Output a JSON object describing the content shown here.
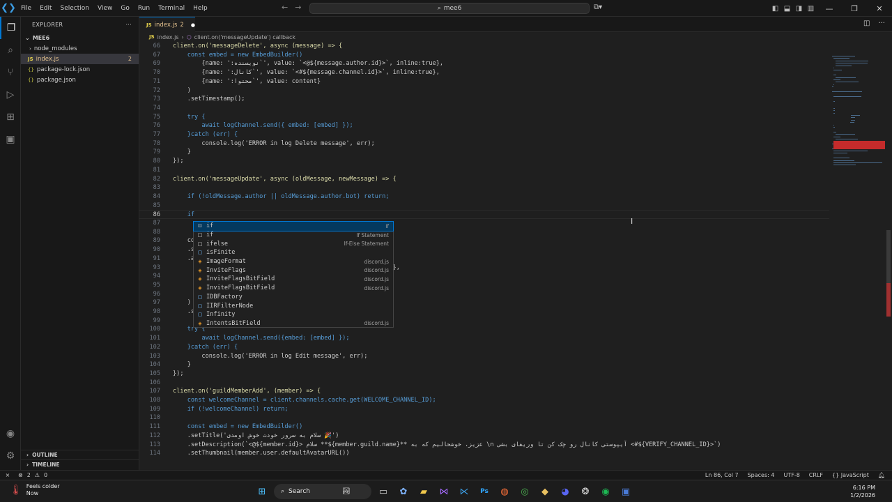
{
  "titlebar": {
    "menu": [
      "File",
      "Edit",
      "Selection",
      "View",
      "Go",
      "Run",
      "Terminal",
      "Help"
    ],
    "search": "mee6"
  },
  "sidebar": {
    "header": "EXPLORER",
    "folder": "MEE6",
    "items": [
      {
        "label": "node_modules",
        "type": "folder"
      },
      {
        "label": "index.js",
        "type": "js",
        "badge": "2"
      },
      {
        "label": "package-lock.json",
        "type": "json"
      },
      {
        "label": "package.json",
        "type": "json"
      }
    ],
    "outline": "OUTLINE",
    "timeline": "TIMELINE"
  },
  "editor": {
    "tab_name": "index.js",
    "tab_badge": "2",
    "breadcrumb": [
      "index.js",
      "client.on('messageUpdate') callback"
    ],
    "lines": [
      {
        "n": "66",
        "t": "client.on('messageDelete', async (message) => {"
      },
      {
        "n": "67",
        "t": "    const embed = new EmbedBuilder()"
      },
      {
        "n": "69",
        "t": "        {name: ':نویسنده`', value: `<@${message.author.id}>`, inline:true},"
      },
      {
        "n": "70",
        "t": "        {name: ':کانال`', value: `<#${message.channel.id}>`, inline:true},"
      },
      {
        "n": "71",
        "t": "        {name: ':محتوا`', value: content}"
      },
      {
        "n": "72",
        "t": "    )"
      },
      {
        "n": "73",
        "t": "    .setTimestamp();"
      },
      {
        "n": "74",
        "t": ""
      },
      {
        "n": "75",
        "t": "    try {"
      },
      {
        "n": "76",
        "t": "        await logChannel.send({ embed: [embed] });"
      },
      {
        "n": "77",
        "t": "    }catch (err) {"
      },
      {
        "n": "78",
        "t": "        console.log('ERROR in log Delete message', err);"
      },
      {
        "n": "79",
        "t": "    }"
      },
      {
        "n": "80",
        "t": "});"
      },
      {
        "n": "81",
        "t": ""
      },
      {
        "n": "82",
        "t": "client.on('messageUpdate', async (oldMessage, newMessage) => {"
      },
      {
        "n": "83",
        "t": ""
      },
      {
        "n": "84",
        "t": "    if (!oldMessage.author || oldMessage.author.bot) return;"
      },
      {
        "n": "85",
        "t": ""
      },
      {
        "n": "86",
        "t": "    if"
      },
      {
        "n": "87",
        "t": ""
      },
      {
        "n": "88",
        "t": ""
      },
      {
        "n": "89",
        "t": "    co"
      },
      {
        "n": "90",
        "t": "    .s"
      },
      {
        "n": "91",
        "t": "    .a"
      },
      {
        "n": "93",
        "t": "                                             , inline: false },"
      },
      {
        "n": "94",
        "t": "                                             , 1024)},"
      },
      {
        "n": "95",
        "t": "                                             , 1024)},"
      },
      {
        "n": "96",
        "t": "                                           ge.url)`}"
      },
      {
        "n": "97",
        "t": "    )"
      },
      {
        "n": "98",
        "t": "    .s"
      },
      {
        "n": "99",
        "t": ""
      },
      {
        "n": "100",
        "t": "    try {"
      },
      {
        "n": "101",
        "t": "        await logChannel.send({embed: [embed] });"
      },
      {
        "n": "102",
        "t": "    }catch (err) {"
      },
      {
        "n": "103",
        "t": "        console.log('ERROR in log Edit message', err);"
      },
      {
        "n": "104",
        "t": "    }"
      },
      {
        "n": "105",
        "t": "});"
      },
      {
        "n": "106",
        "t": ""
      },
      {
        "n": "107",
        "t": "client.on('guildMemberAdd', (member) => {"
      },
      {
        "n": "108",
        "t": "    const welcomeChannel = client.channels.cache.get(WELCOME_CHANNEL_ID);"
      },
      {
        "n": "109",
        "t": "    if (!welcomeChannel) return;"
      },
      {
        "n": "110",
        "t": ""
      },
      {
        "n": "111",
        "t": "    const embed = new EmbedBuilder()"
      },
      {
        "n": "112",
        "t": "    .setTitle('سلام به سرور خودت خوش اومدی 🎉')"
      },
      {
        "n": "113",
        "t": "    .setDescription(`<@${member.id}> سلام **${member.guild.name}** عزیز، خوشحالیم که به \\n آیپوستی کانال رو چک کن تا وریفای بشی <#${VERIFY_CHANNEL_ID}>`)"
      },
      {
        "n": "114",
        "t": "    .setThumbnail(member.user.defaultAvatarURL())"
      }
    ]
  },
  "suggestions": [
    {
      "icon": "keyword",
      "label": "if",
      "detail": "if"
    },
    {
      "icon": "snippet",
      "label": "if",
      "detail": "If Statement"
    },
    {
      "icon": "snippet",
      "label": "ifelse",
      "detail": "If-Else Statement"
    },
    {
      "icon": "variable",
      "label": "isFinite",
      "detail": ""
    },
    {
      "icon": "class",
      "label": "ImageFormat",
      "detail": "discord.js"
    },
    {
      "icon": "class",
      "label": "InviteFlags",
      "detail": "discord.js"
    },
    {
      "icon": "class",
      "label": "InviteFlagsBitField",
      "detail": "discord.js"
    },
    {
      "icon": "class",
      "label": "InviteFlagsBitField",
      "detail": "discord.js"
    },
    {
      "icon": "variable",
      "label": "IDBFactory",
      "detail": ""
    },
    {
      "icon": "variable",
      "label": "IIRFilterNode",
      "detail": ""
    },
    {
      "icon": "variable",
      "label": "Infinity",
      "detail": ""
    },
    {
      "icon": "class",
      "label": "IntentsBitField",
      "detail": "discord.js"
    }
  ],
  "statusbar": {
    "errors": "2",
    "warnings": "0",
    "position": "Ln 86, Col 7",
    "spaces": "Spaces: 4",
    "encoding": "UTF-8",
    "eol": "CRLF",
    "language": "JavaScript"
  },
  "taskbar": {
    "weather_title": "Feels colder",
    "weather_sub": "Now",
    "search": "Search",
    "time": "6:16 PM",
    "date": "1/2/2026"
  }
}
